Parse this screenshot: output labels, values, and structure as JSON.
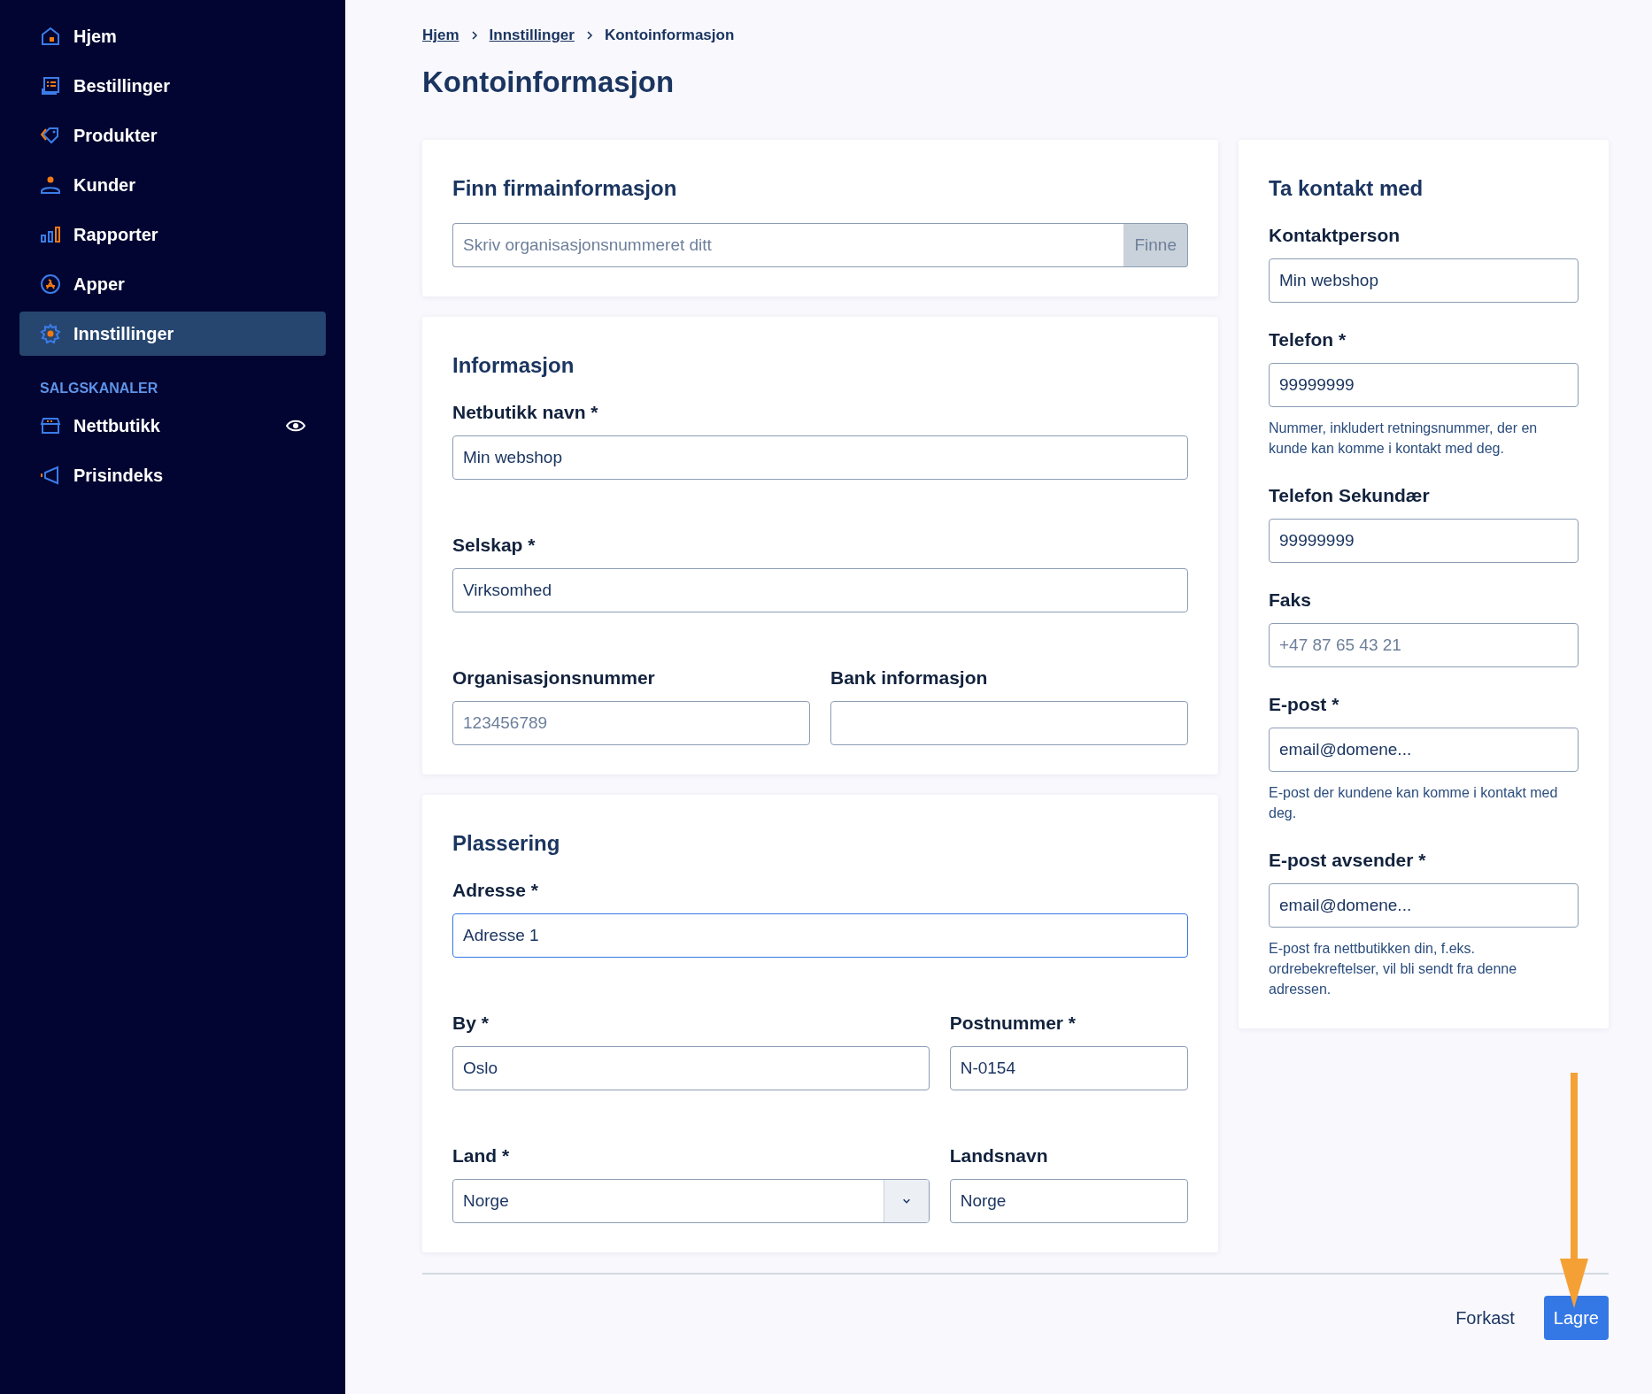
{
  "sidebar": {
    "items": [
      {
        "label": "Hjem",
        "selected": false
      },
      {
        "label": "Bestillinger",
        "selected": false
      },
      {
        "label": "Produkter",
        "selected": false
      },
      {
        "label": "Kunder",
        "selected": false
      },
      {
        "label": "Rapporter",
        "selected": false
      },
      {
        "label": "Apper",
        "selected": false
      },
      {
        "label": "Innstillinger",
        "selected": true
      }
    ],
    "section_title": "SALGSKANALER",
    "channels": [
      {
        "label": "Nettbutikk",
        "selected": false,
        "preview": true
      },
      {
        "label": "Prisindeks",
        "selected": false,
        "preview": false
      }
    ]
  },
  "breadcrumb": [
    {
      "label": "Hjem",
      "kind": "link"
    },
    {
      "label": "Innstillinger",
      "kind": "link"
    },
    {
      "label": "Kontoinformasjon",
      "kind": "current"
    }
  ],
  "title": "Kontoinformasjon",
  "search_card": {
    "title": "Finn firmainformasjon",
    "placeholder": "Skriv organisasjonsnummeret ditt",
    "button": "Finne"
  },
  "cards": [
    {
      "title": "Informasjon",
      "rows": [
        [
          {
            "label": "Netbutikk navn *",
            "kind": "text",
            "value": "Min webshop",
            "focused": false
          }
        ],
        [
          {
            "label": "Selskap *",
            "kind": "text",
            "value": "Virksomhed",
            "focused": false
          }
        ],
        [
          {
            "label": "Organisasjonsnummer",
            "kind": "text",
            "placeholder": "123456789",
            "focused": false
          },
          {
            "label": "Bank informasjon",
            "kind": "text",
            "focused": false
          }
        ]
      ]
    },
    {
      "title": "Plassering",
      "rows": [
        [
          {
            "label": "Adresse *",
            "kind": "text",
            "value": "Adresse 1",
            "focused": true
          }
        ],
        [
          {
            "label": "By *",
            "kind": "text",
            "value": "Oslo",
            "focused": false
          },
          {
            "label": "Postnummer *",
            "kind": "text",
            "value": "N-0154",
            "focused": false
          }
        ],
        [
          {
            "label": "Land *",
            "kind": "select",
            "value": "Norge",
            "focused": false
          },
          {
            "label": "Landsnavn",
            "kind": "text",
            "value": "Norge",
            "focused": false
          }
        ]
      ]
    }
  ],
  "contact_card": {
    "title": "Ta kontakt med",
    "fields": [
      {
        "label": "Kontaktperson",
        "kind": "text",
        "value": "Min webshop",
        "focused": false
      },
      {
        "label": "Telefon *",
        "kind": "text",
        "value": "99999999",
        "focused": false,
        "help": "Nummer, inkludert retningsnummer, der en kunde kan komme i kontakt med deg."
      },
      {
        "label": "Telefon Sekundær",
        "kind": "text",
        "value": "99999999",
        "focused": false
      },
      {
        "label": "Faks",
        "kind": "text",
        "placeholder": "+47 87 65 43 21",
        "focused": false
      },
      {
        "label": "E-post *",
        "kind": "text",
        "value": "email@domene...",
        "focused": false,
        "help": "E-post der kundene kan komme i kontakt med deg."
      },
      {
        "label": "E-post avsender *",
        "kind": "text",
        "value": "email@domene...",
        "focused": false,
        "help": "E-post fra nettbutikken din, f.eks. ordrebekreftelser, vil bli sendt fra denne adressen."
      }
    ]
  },
  "actions": [
    {
      "label": "Forkast",
      "kind": "secondary"
    },
    {
      "label": "Lagre",
      "kind": "primary"
    }
  ]
}
